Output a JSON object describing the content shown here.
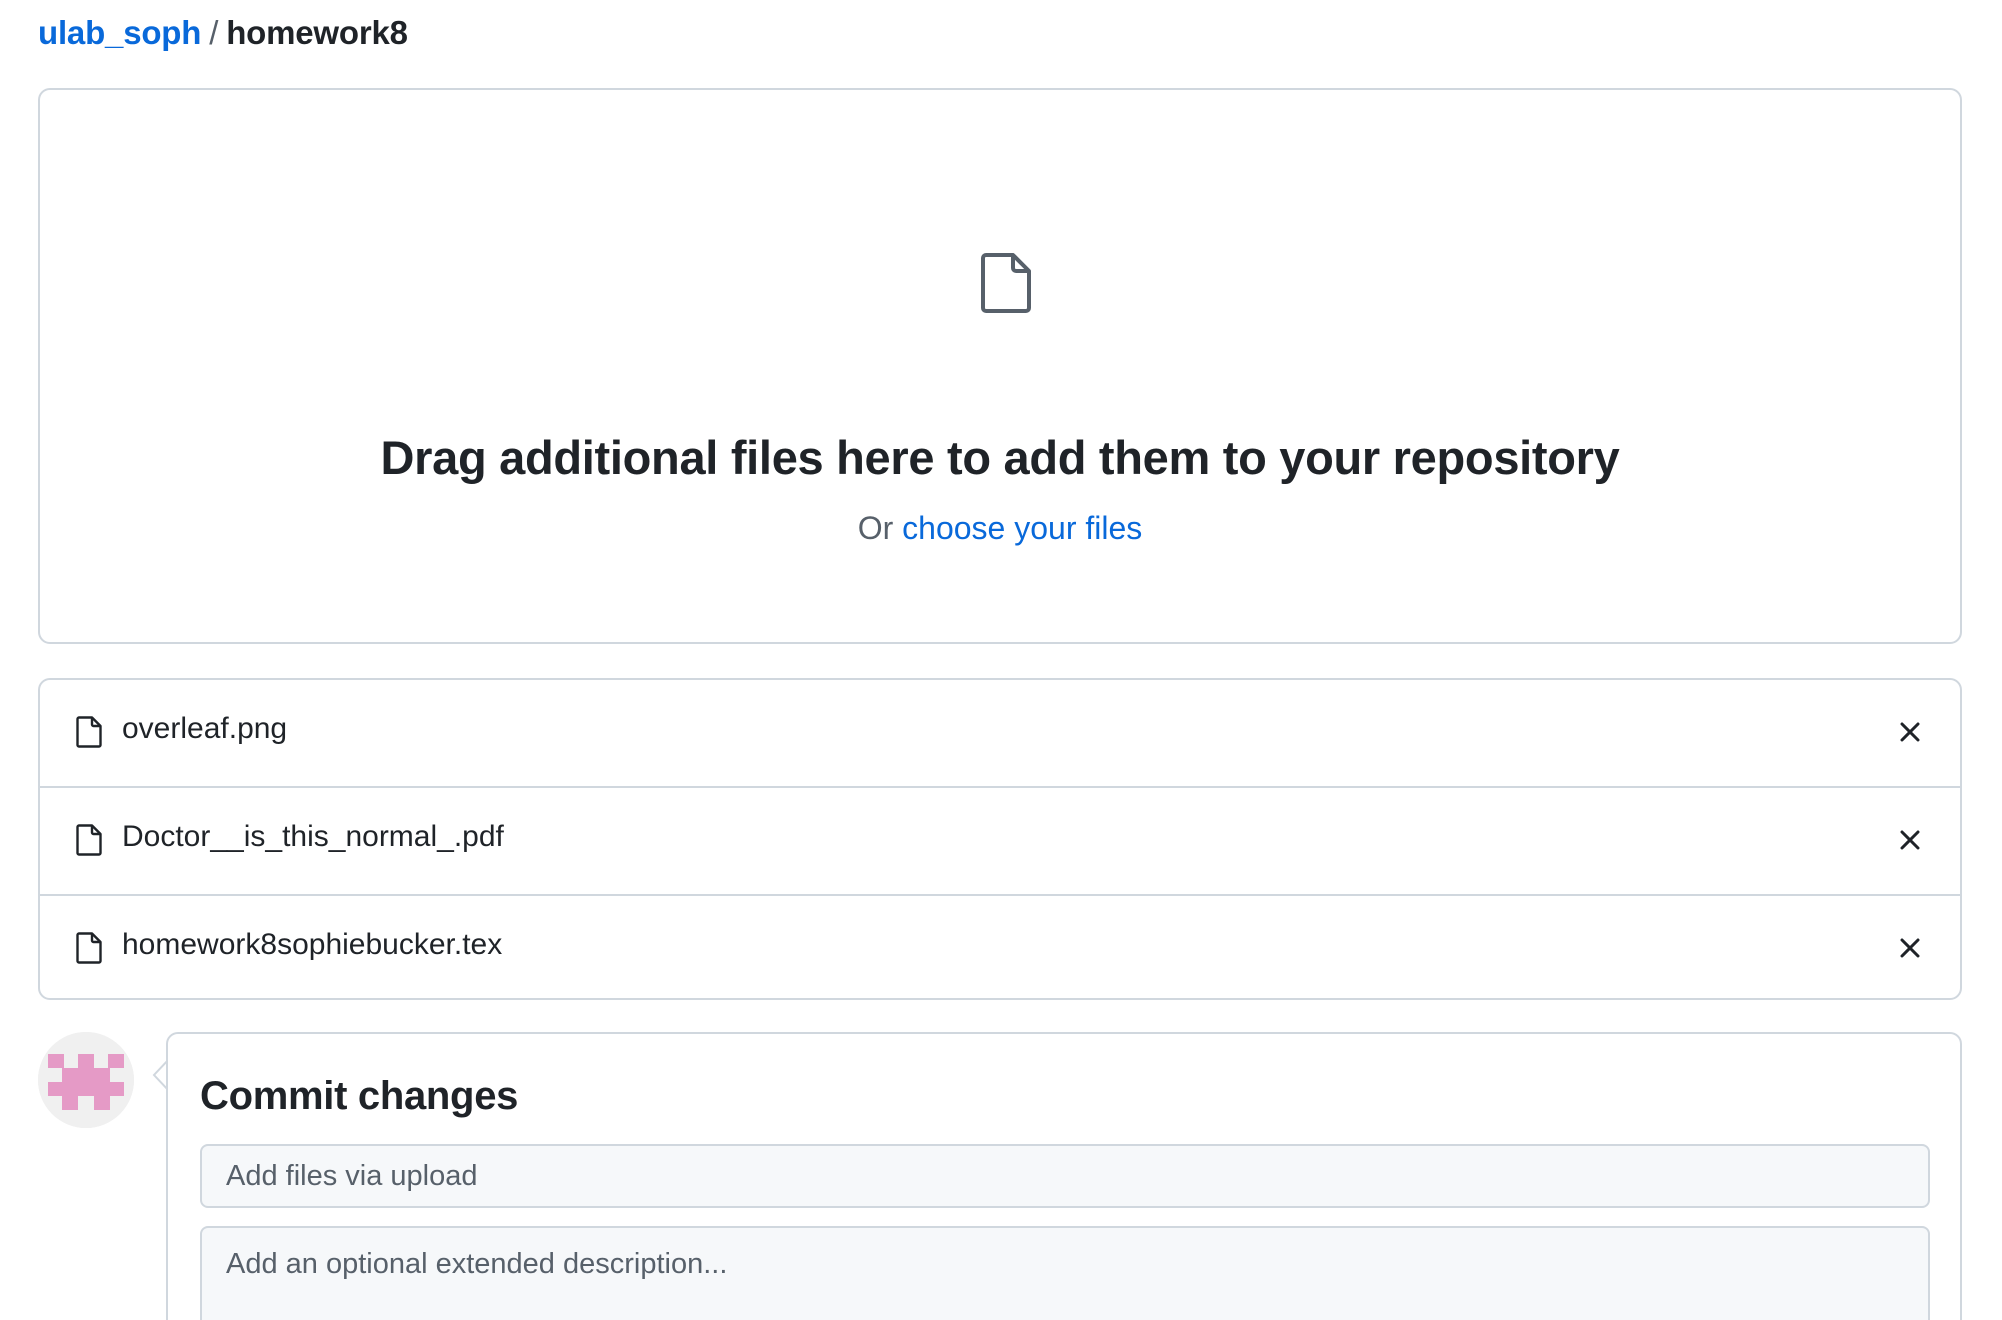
{
  "breadcrumb": {
    "owner": "ulab_soph",
    "separator": "/",
    "repo": "homework8"
  },
  "dropzone": {
    "icon": "file-icon",
    "title": "Drag additional files here to add them to your repository",
    "sub_prefix": "Or",
    "sub_link": "choose your files"
  },
  "files": [
    {
      "name": "overleaf.png",
      "icon": "file-icon",
      "action_icon": "close-icon"
    },
    {
      "name": "Doctor__is_this_normal_.pdf",
      "icon": "file-icon",
      "action_icon": "close-icon"
    },
    {
      "name": "homework8sophiebucker.tex",
      "icon": "file-icon",
      "action_icon": "close-icon"
    }
  ],
  "commit": {
    "title": "Commit changes",
    "summary_placeholder": "Add files via upload",
    "description_placeholder": "Add an optional extended description..."
  },
  "colors": {
    "link": "#0969da",
    "text": "#1f2328",
    "muted": "#57606a",
    "border": "#d0d7de",
    "input_bg": "#f6f8fa",
    "avatar_pink": "#e59ac6"
  }
}
